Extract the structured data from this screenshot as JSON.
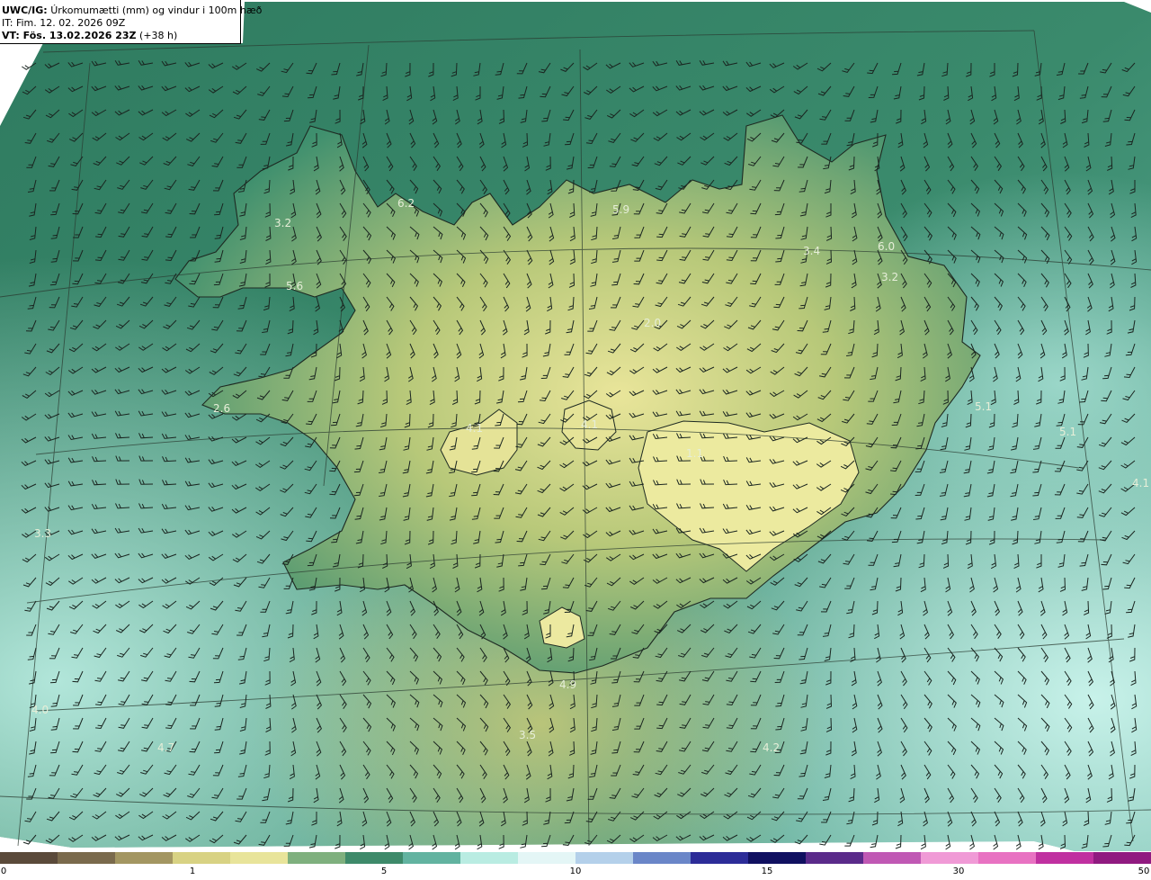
{
  "header": {
    "model": "UWC/IG:",
    "title": "Úrkomumætti (mm) og vindur i 100m hæð",
    "init_time": "IT: Fim. 12. 02. 2026 09Z",
    "valid_prefix": "VT: Fös. 13.02.2026 23Z",
    "valid_lead": "(+38 h)"
  },
  "colorbar": {
    "ticks": [
      "0",
      "1",
      "5",
      "10",
      "15",
      "30",
      "50"
    ],
    "colors": [
      "#5a4a3a",
      "#7a6a4c",
      "#a39661",
      "#d8d283",
      "#e8e49a",
      "#7fb07e",
      "#3e8a6a",
      "#62b3a0",
      "#b9ece2",
      "#e4f6f6",
      "#b4d0ea",
      "#6a86c8",
      "#2c2c98",
      "#101060",
      "#5a2a8a",
      "#c058b4",
      "#f09ad6",
      "#e872c2",
      "#c030a0",
      "#901a80"
    ]
  },
  "map": {
    "labels": [
      "6.2",
      "5.9",
      "3.2",
      "5.6",
      "3.4",
      "6.0",
      "3.2",
      "2.0",
      "2.6",
      "5.1",
      "5.1",
      "4.1",
      "4.9",
      "3.5",
      "4.2",
      "3.3",
      "4.7",
      "1.1",
      "4.1",
      "4.1",
      "4.0"
    ]
  }
}
